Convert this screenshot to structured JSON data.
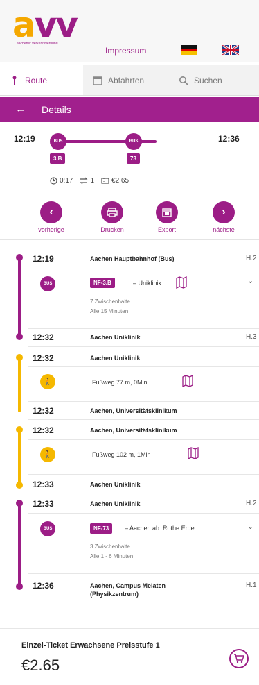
{
  "header": {
    "logo_text": "avv",
    "logo_subtitle": "aachener verkehrsverbund",
    "impressum": "Impressum"
  },
  "tabs": [
    {
      "label": "Route",
      "icon": "route-pin-icon"
    },
    {
      "label": "Abfahrten",
      "icon": "calendar-icon"
    },
    {
      "label": "Suchen",
      "icon": "search-icon"
    }
  ],
  "detail_bar": {
    "back": "←",
    "title": "Details"
  },
  "summary": {
    "start_time": "12:19",
    "end_time": "12:36",
    "legs": [
      {
        "mode": "BUS",
        "line": "3.B"
      },
      {
        "mode": "BUS",
        "line": "73"
      }
    ],
    "duration": "0:17",
    "transfers": "1",
    "price": "€2.65"
  },
  "actions": [
    {
      "label": "vorherige",
      "icon": "chevron-left-icon"
    },
    {
      "label": "Drucken",
      "icon": "printer-icon"
    },
    {
      "label": "Export",
      "icon": "calendar-export-icon"
    },
    {
      "label": "nächste",
      "icon": "chevron-right-icon"
    }
  ],
  "timeline": {
    "leg1": {
      "dep_time": "12:19",
      "dep_stop": "Aachen Hauptbahnhof (Bus)",
      "dep_plat": "H.2",
      "mode": "BUS",
      "line": "NF-3.B",
      "direction": "– Uniklinik",
      "stops": "7 Zwischenhalte",
      "frequency": "Alle 15 Minuten",
      "arr_time": "12:32",
      "arr_stop": "Aachen Uniklinik",
      "arr_plat": "H.3"
    },
    "walk1": {
      "dep_time": "12:32",
      "dep_stop": "Aachen Uniklinik",
      "text": "Fußweg   77 m, 0Min",
      "arr_time": "12:32",
      "arr_stop": "Aachen, Universitätsklinikum"
    },
    "walk2": {
      "dep_time": "12:32",
      "dep_stop": "Aachen, Universitätsklinikum",
      "text": "Fußweg   102 m, 1Min",
      "arr_time": "12:33",
      "arr_stop": "Aachen Uniklinik"
    },
    "leg2": {
      "dep_time": "12:33",
      "dep_stop": "Aachen Uniklinik",
      "dep_plat": "H.2",
      "mode": "BUS",
      "line": "NF-73",
      "direction": "– Aachen ab. Rothe Erde ...",
      "stops": "3 Zwischenhalte",
      "frequency": "Alle 1 - 6 Minuten",
      "arr_time": "12:36",
      "arr_stop": "Aachen, Campus Melaten",
      "arr_stop2": "(Physikzentrum)",
      "arr_plat": "H.1"
    }
  },
  "ticket": {
    "name": "Einzel-Ticket Erwachsene Preisstufe 1",
    "price": "€2.65"
  },
  "colors": {
    "brand": "#9c1d86",
    "accent": "#f5a800",
    "walk": "#f5b800"
  }
}
